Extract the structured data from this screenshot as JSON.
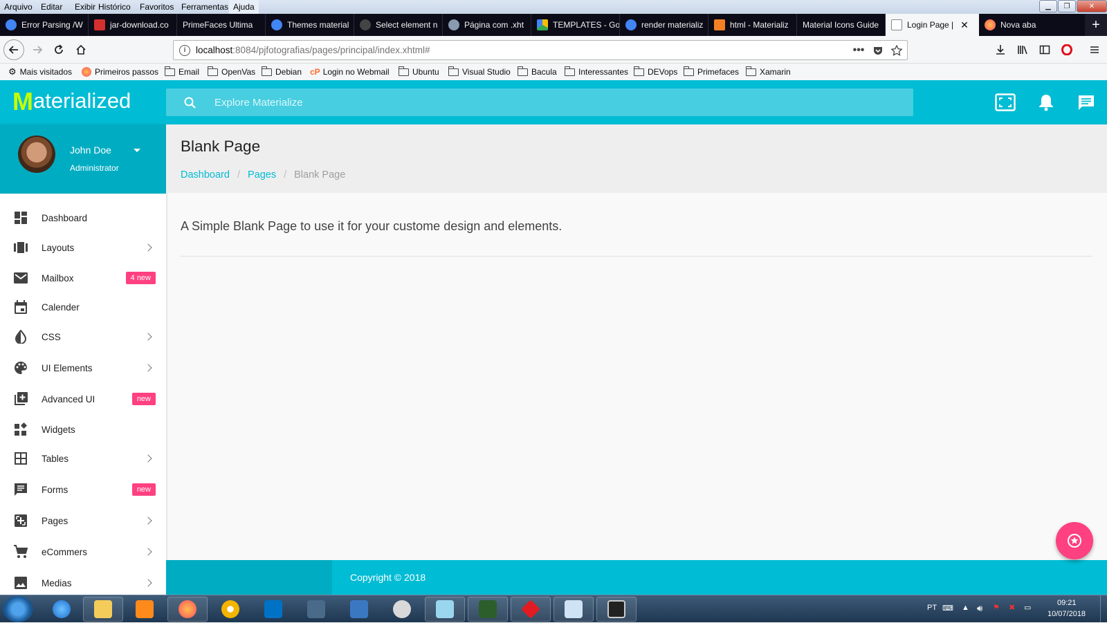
{
  "browser": {
    "menu": [
      "Arquivo",
      "Editar",
      "Exibir",
      "Histórico",
      "Favoritos",
      "Ferramentas",
      "Ajuda"
    ],
    "tabs": [
      {
        "label": "Error Parsing /W",
        "color": "#4285f4"
      },
      {
        "label": "jar-download.co",
        "color": "#d32f2f"
      },
      {
        "label": "PrimeFaces Ultima",
        "color": ""
      },
      {
        "label": "Themes material",
        "color": "#4285f4"
      },
      {
        "label": "Select element n",
        "color": "#333333"
      },
      {
        "label": "Página com .xht",
        "color": "#8a9ab0"
      },
      {
        "label": "TEMPLATES - Go",
        "color": "#fbbc05"
      },
      {
        "label": "render materializ",
        "color": "#4285f4"
      },
      {
        "label": "html - Materializ",
        "color": "#f48024"
      },
      {
        "label": "Material Icons Guide",
        "color": ""
      },
      {
        "label": "Login Page |",
        "color": "#cccccc"
      },
      {
        "label": "Nova aba",
        "color": "#ff7139"
      }
    ],
    "url_host": "localhost",
    "url_rest": ":8084/pjfotografias/pages/principal/index.xhtml#",
    "bookmarks": [
      {
        "label": "Mais visitados",
        "icon": "gear-icon"
      },
      {
        "label": "Primeiros passos",
        "icon": "firefox-icon"
      },
      {
        "label": "Email",
        "icon": "folder-icon"
      },
      {
        "label": "OpenVas",
        "icon": "folder-icon"
      },
      {
        "label": "Debian",
        "icon": "folder-icon"
      },
      {
        "label": "Login no Webmail",
        "icon": "cpanel-icon"
      },
      {
        "label": "Ubuntu",
        "icon": "folder-icon"
      },
      {
        "label": "Visual Studio",
        "icon": "folder-icon"
      },
      {
        "label": "Bacula",
        "icon": "folder-icon"
      },
      {
        "label": "Interessantes",
        "icon": "folder-icon"
      },
      {
        "label": "DEVops",
        "icon": "folder-icon"
      },
      {
        "label": "Primefaces",
        "icon": "folder-icon"
      },
      {
        "label": "Xamarin",
        "icon": "folder-icon"
      }
    ]
  },
  "app": {
    "logo_initial": "M",
    "logo_rest": "aterialized",
    "search_placeholder": "Explore Materialize",
    "accent": "#00bcd4",
    "badge_color": "#ff4081"
  },
  "profile": {
    "name": "John Doe",
    "role": "Administrator"
  },
  "sidebar": [
    {
      "label": "Dashboard",
      "icon": "dashboard-icon",
      "chevron": false,
      "badge": ""
    },
    {
      "label": "Layouts",
      "icon": "view-array-icon",
      "chevron": true,
      "badge": ""
    },
    {
      "label": "Mailbox",
      "icon": "email-icon",
      "chevron": false,
      "badge": "4 new"
    },
    {
      "label": "Calender",
      "icon": "calendar-icon",
      "chevron": false,
      "badge": ""
    },
    {
      "label": "CSS",
      "icon": "invert-colors-icon",
      "chevron": true,
      "badge": ""
    },
    {
      "label": "UI Elements",
      "icon": "palette-icon",
      "chevron": true,
      "badge": ""
    },
    {
      "label": "Advanced UI",
      "icon": "library-add-icon",
      "chevron": false,
      "badge": "new"
    },
    {
      "label": "Widgets",
      "icon": "widgets-icon",
      "chevron": false,
      "badge": ""
    },
    {
      "label": "Tables",
      "icon": "grid-icon",
      "chevron": true,
      "badge": ""
    },
    {
      "label": "Forms",
      "icon": "chat-icon",
      "chevron": false,
      "badge": "new"
    },
    {
      "label": "Pages",
      "icon": "pages-icon",
      "chevron": true,
      "badge": ""
    },
    {
      "label": "eCommers",
      "icon": "cart-icon",
      "chevron": true,
      "badge": ""
    },
    {
      "label": "Medias",
      "icon": "image-icon",
      "chevron": true,
      "badge": ""
    }
  ],
  "page": {
    "title": "Blank Page",
    "breadcrumb": [
      "Dashboard",
      "Pages",
      "Blank Page"
    ],
    "breadcrumb_sep": "/",
    "text": "A Simple Blank Page to use it for your custome design and elements."
  },
  "footer": {
    "copyright": "Copyright © 2018"
  },
  "taskbar": {
    "lang": "PT",
    "time": "09:21",
    "date": "10/07/2018"
  }
}
